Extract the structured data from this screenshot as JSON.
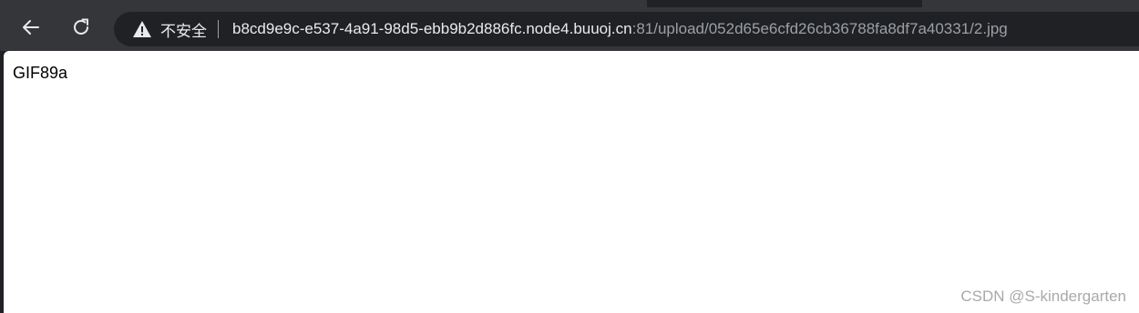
{
  "toolbar": {
    "back_icon": "arrow-left-icon",
    "reload_icon": "reload-icon"
  },
  "omnibox": {
    "security_icon": "warning-triangle-icon",
    "security_label": "不安全",
    "url_host": "b8cd9e9c-e537-4a91-98d5-ebb9b2d886fc.node4.buuoj.cn",
    "url_rest": ":81/upload/052d65e6cfd26cb36788fa8df7a40331/2.jpg"
  },
  "page": {
    "body_text": "GIF89a"
  },
  "watermark": {
    "text": "CSDN @S-kindergarten"
  },
  "colors": {
    "toolbar_bg": "#35363a",
    "omnibox_bg": "#202124",
    "page_bg": "#ffffff",
    "url_host": "#e8eaed",
    "url_rest": "#9aa0a6"
  }
}
